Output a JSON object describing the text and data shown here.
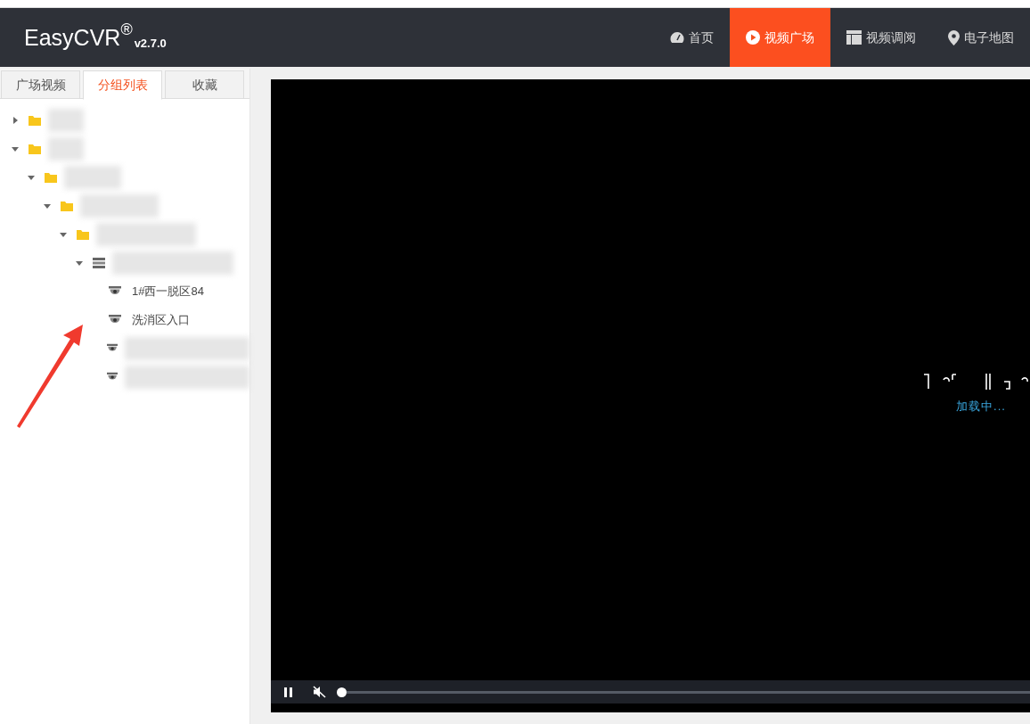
{
  "header": {
    "logo": "EasyCVR",
    "logo_mark": "®",
    "version": "v2.7.0",
    "nav": [
      {
        "label": "首页",
        "kind": "gauge",
        "selected": false
      },
      {
        "label": "视频广场",
        "kind": "play",
        "selected": true
      },
      {
        "label": "视频调阅",
        "kind": "layout",
        "selected": false
      },
      {
        "label": "电子地图",
        "kind": "pin",
        "selected": false
      }
    ]
  },
  "sidebar": {
    "tabs": [
      {
        "label": "广场视频",
        "selected": false
      },
      {
        "label": "分组列表",
        "selected": true
      },
      {
        "label": "收藏",
        "selected": false
      }
    ],
    "tree": [
      {
        "kind": "folder",
        "expanded": false,
        "redacted": true
      },
      {
        "kind": "folder",
        "expanded": true,
        "redacted": true,
        "children": [
          {
            "kind": "folder",
            "expanded": true,
            "redacted": true,
            "children": [
              {
                "kind": "folder",
                "expanded": true,
                "redacted": true,
                "children": [
                  {
                    "kind": "folder",
                    "expanded": true,
                    "redacted": true,
                    "children": [
                      {
                        "kind": "device",
                        "expanded": true,
                        "redacted": true,
                        "children": [
                          {
                            "kind": "camera",
                            "label": "1#西一脱区84"
                          },
                          {
                            "kind": "camera",
                            "label": "洗消区入口"
                          },
                          {
                            "kind": "camera",
                            "redacted": true
                          },
                          {
                            "kind": "camera",
                            "redacted": true
                          }
                        ]
                      }
                    ]
                  }
                ]
              }
            ]
          }
        ]
      }
    ]
  },
  "player": {
    "status": "加载中...",
    "playing": true,
    "muted": true,
    "level": 0
  }
}
